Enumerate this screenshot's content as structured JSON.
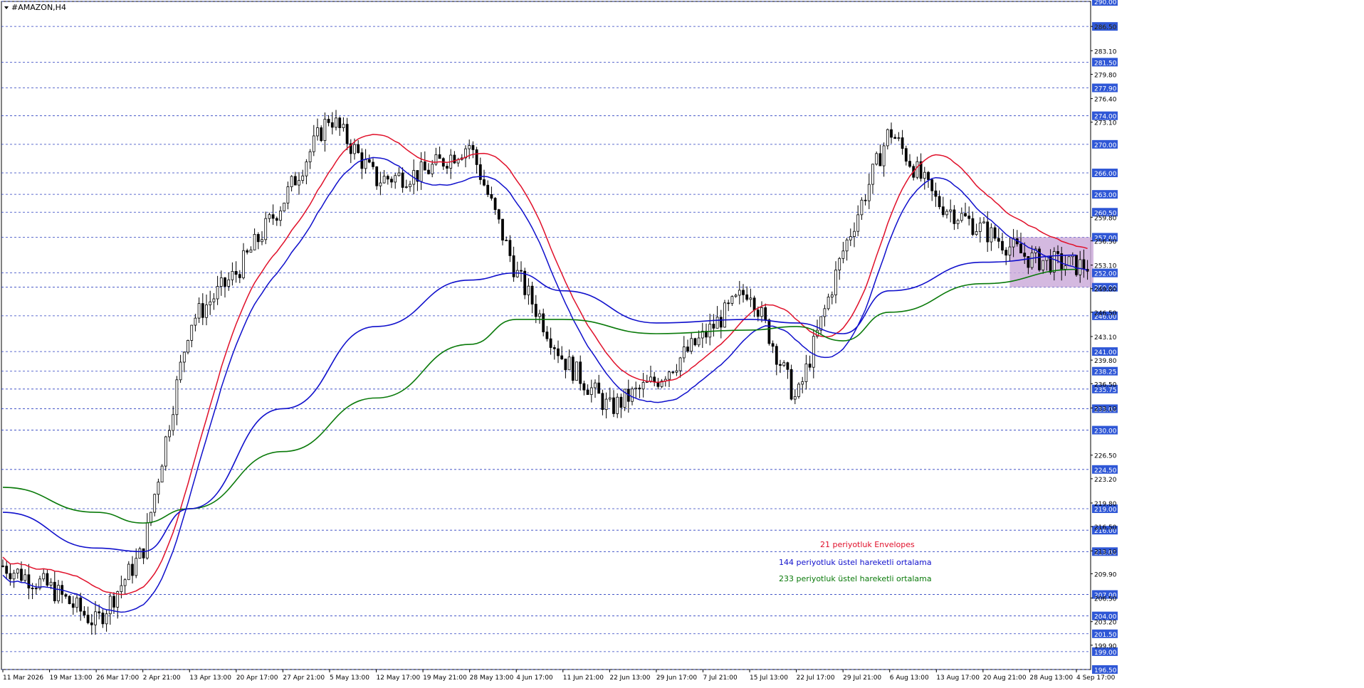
{
  "window": {
    "title": "#AMAZON,H4"
  },
  "colors": {
    "background": "#ffffff",
    "grid": "#2a3fbf",
    "candles": "#000000",
    "envelope": "#e0102a",
    "ema144": "#1010cc",
    "ema233": "#0a7a0a",
    "highlight_box": "#c9a8d8",
    "price_label_bg": "#2f57d6",
    "price_label_text": "#ffffff"
  },
  "chart_data": {
    "type": "candlestick",
    "title": "#AMAZON,H4",
    "ylim": [
      196.5,
      290.0
    ],
    "grid": true,
    "y_ticks_plain": [
      "286.50",
      "283.10",
      "279.80",
      "276.40",
      "273.10",
      "259.80",
      "256.50",
      "253.10",
      "249.80",
      "246.50",
      "243.10",
      "239.80",
      "236.50",
      "233.10",
      "226.50",
      "223.20",
      "219.80",
      "216.50",
      "213.10",
      "209.90",
      "206.50",
      "203.20",
      "199.90"
    ],
    "y_levels_labeled": [
      "290.00",
      "286.50",
      "281.50",
      "277.90",
      "274.00",
      "270.00",
      "266.00",
      "263.00",
      "260.50",
      "257.00",
      "252.00",
      "250.00",
      "246.00",
      "241.00",
      "238.25",
      "235.75",
      "233.00",
      "230.00",
      "224.50",
      "219.00",
      "216.00",
      "213.00",
      "207.00",
      "204.00",
      "201.50",
      "199.00",
      "196.50"
    ],
    "x_tick_labels": [
      "11 Mar 2026",
      "19 Mar 13:00",
      "26 Mar 17:00",
      "2 Apr 21:00",
      "13 Apr 13:00",
      "20 Apr 17:00",
      "27 Apr 21:00",
      "5 May 13:00",
      "12 May 17:00",
      "19 May 21:00",
      "28 May 13:00",
      "4 Jun 17:00",
      "11 Jun 21:00",
      "22 Jun 13:00",
      "29 Jun 17:00",
      "7 Jul 21:00",
      "15 Jul 13:00",
      "22 Jul 17:00",
      "29 Jul 21:00",
      "6 Aug 13:00",
      "13 Aug 17:00",
      "20 Aug 21:00",
      "28 Aug 13:00",
      "4 Sep 17:00"
    ],
    "price_path_anchors": [
      {
        "x": "11 Mar 2026",
        "close": 211.0
      },
      {
        "x": "19 Mar 13:00",
        "close": 208.0
      },
      {
        "x": "26 Mar 17:00",
        "close": 203.0
      },
      {
        "x": "2 Apr 21:00",
        "close": 213.0
      },
      {
        "x": "13 Apr 13:00",
        "close": 245.0
      },
      {
        "x": "20 Apr 17:00",
        "close": 252.0
      },
      {
        "x": "27 Apr 21:00",
        "close": 262.0
      },
      {
        "x": "5 May 13:00",
        "close": 274.0
      },
      {
        "x": "12 May 17:00",
        "close": 265.0
      },
      {
        "x": "19 May 21:00",
        "close": 266.0
      },
      {
        "x": "28 May 13:00",
        "close": 270.0
      },
      {
        "x": "4 Jun 17:00",
        "close": 252.0
      },
      {
        "x": "11 Jun 21:00",
        "close": 240.0
      },
      {
        "x": "22 Jun 13:00",
        "close": 233.0
      },
      {
        "x": "29 Jun 17:00",
        "close": 237.0
      },
      {
        "x": "7 Jul 21:00",
        "close": 243.0
      },
      {
        "x": "15 Jul 13:00",
        "close": 250.0
      },
      {
        "x": "22 Jul 17:00",
        "close": 234.0
      },
      {
        "x": "29 Jul 21:00",
        "close": 255.0
      },
      {
        "x": "6 Aug 13:00",
        "close": 272.0
      },
      {
        "x": "13 Aug 17:00",
        "close": 262.0
      },
      {
        "x": "20 Aug 21:00",
        "close": 258.0
      },
      {
        "x": "28 Aug 13:00",
        "close": 254.0
      },
      {
        "x": "4 Sep 17:00",
        "close": 253.0
      }
    ],
    "series": [
      {
        "name": "21 periyotluk Envelopes",
        "color": "#e0102a"
      },
      {
        "name": "144 periyotluk üstel hareketli ortalama",
        "color": "#1010cc"
      },
      {
        "name": "233 periyotluk üstel hareketli ortalama",
        "color": "#0a7a0a"
      }
    ],
    "ema144_path": [
      {
        "x": "11 Mar 2026",
        "y": 218.5
      },
      {
        "x": "26 Mar 17:00",
        "y": 213.5
      },
      {
        "x": "2 Apr 21:00",
        "y": 213.0
      },
      {
        "x": "13 Apr 13:00",
        "y": 219.0
      },
      {
        "x": "27 Apr 21:00",
        "y": 233.0
      },
      {
        "x": "12 May 17:00",
        "y": 244.5
      },
      {
        "x": "28 May 13:00",
        "y": 251.0
      },
      {
        "x": "4 Jun 17:00",
        "y": 252.0
      },
      {
        "x": "11 Jun 21:00",
        "y": 249.5
      },
      {
        "x": "29 Jun 17:00",
        "y": 245.0
      },
      {
        "x": "15 Jul 13:00",
        "y": 245.5
      },
      {
        "x": "22 Jul 17:00",
        "y": 245.0
      },
      {
        "x": "29 Jul 21:00",
        "y": 243.5
      },
      {
        "x": "6 Aug 13:00",
        "y": 249.5
      },
      {
        "x": "20 Aug 21:00",
        "y": 253.5
      },
      {
        "x": "4 Sep 17:00",
        "y": 254.5
      }
    ],
    "ema233_path": [
      {
        "x": "11 Mar 2026",
        "y": 222.0
      },
      {
        "x": "26 Mar 17:00",
        "y": 218.5
      },
      {
        "x": "2 Apr 21:00",
        "y": 217.0
      },
      {
        "x": "13 Apr 13:00",
        "y": 219.0
      },
      {
        "x": "27 Apr 21:00",
        "y": 227.0
      },
      {
        "x": "12 May 17:00",
        "y": 234.5
      },
      {
        "x": "28 May 13:00",
        "y": 242.0
      },
      {
        "x": "4 Jun 17:00",
        "y": 245.5
      },
      {
        "x": "11 Jun 21:00",
        "y": 245.5
      },
      {
        "x": "29 Jun 17:00",
        "y": 243.5
      },
      {
        "x": "15 Jul 13:00",
        "y": 244.0
      },
      {
        "x": "22 Jul 17:00",
        "y": 244.5
      },
      {
        "x": "29 Jul 21:00",
        "y": 242.5
      },
      {
        "x": "6 Aug 13:00",
        "y": 246.5
      },
      {
        "x": "20 Aug 21:00",
        "y": 250.5
      },
      {
        "x": "4 Sep 17:00",
        "y": 252.5
      }
    ],
    "highlight_zone": {
      "x_from": "28 Aug 13:00",
      "x_to": "4 Sep 17:00",
      "y_from": 250.0,
      "y_to": 257.0
    },
    "legend_placement": "center-bottom"
  }
}
